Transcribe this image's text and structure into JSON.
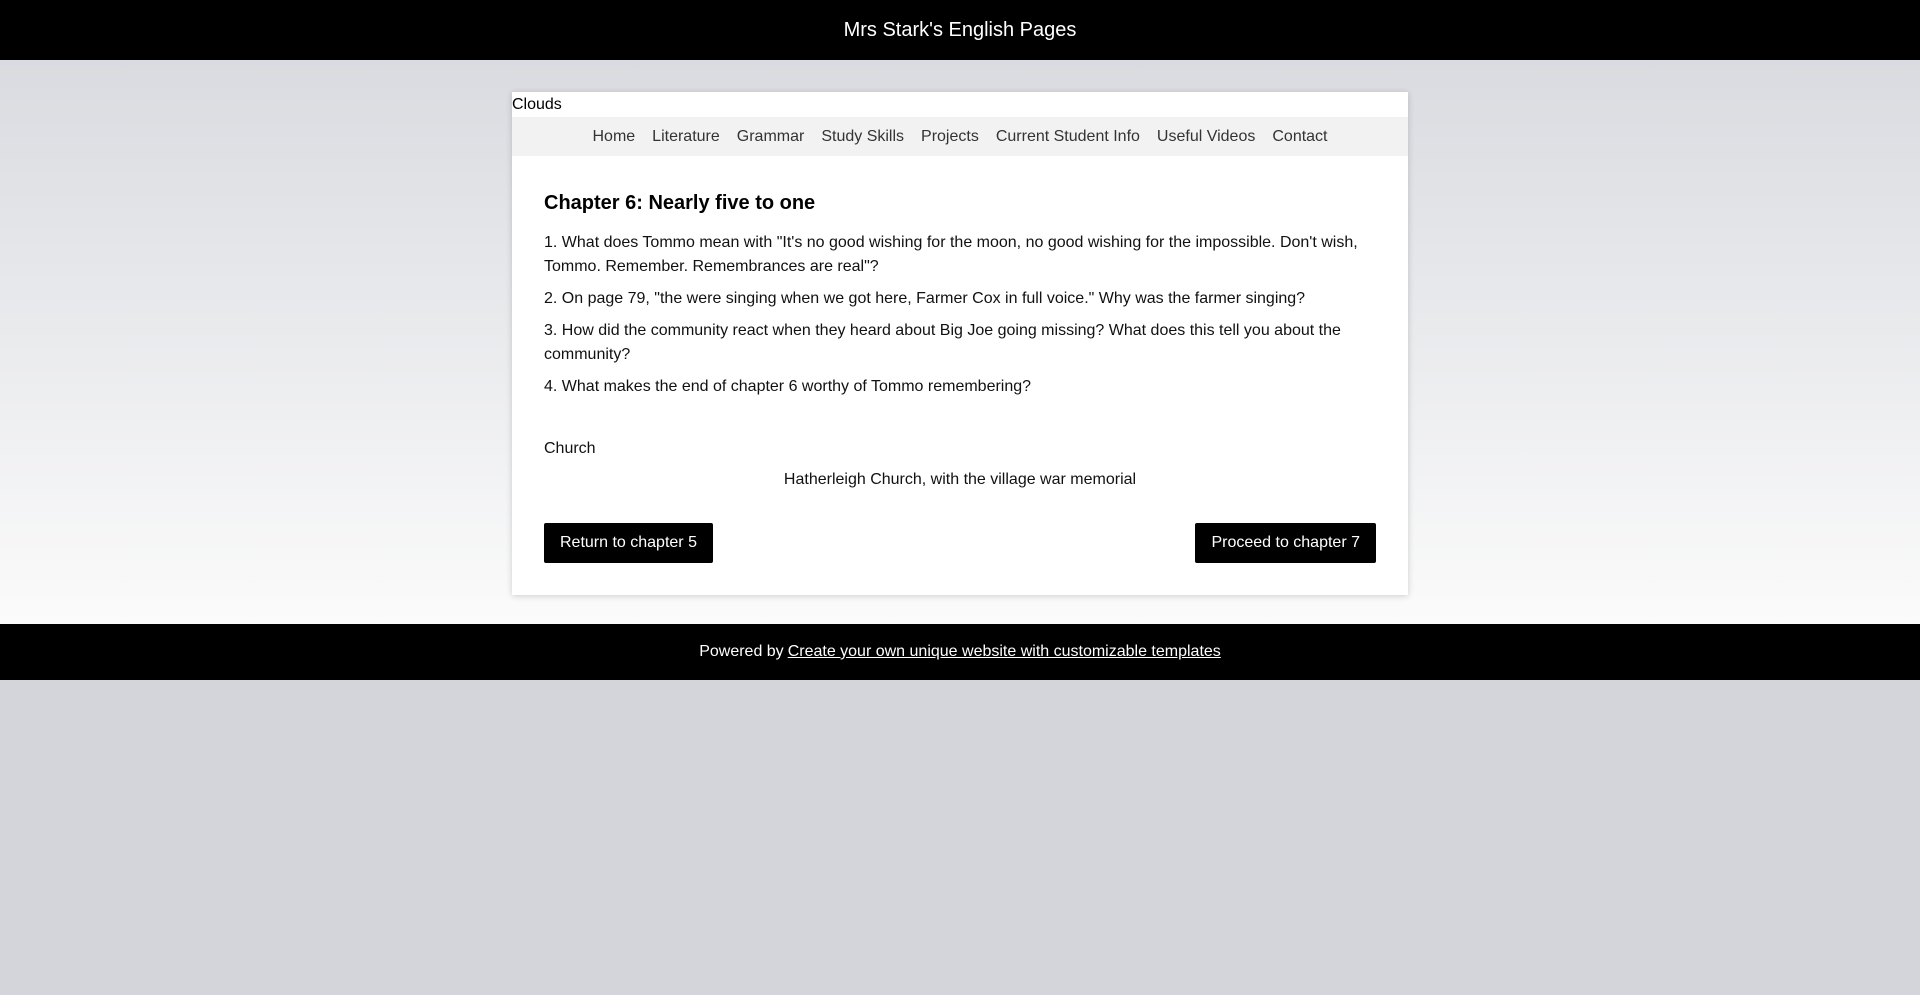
{
  "header": {
    "title": "Mrs Stark's English Pages"
  },
  "banner": {
    "alt_text": "Clouds"
  },
  "nav": {
    "items": [
      {
        "label": "Home"
      },
      {
        "label": "Literature"
      },
      {
        "label": "Grammar"
      },
      {
        "label": "Study Skills"
      },
      {
        "label": "Projects"
      },
      {
        "label": "Current Student Info"
      },
      {
        "label": "Useful Videos"
      },
      {
        "label": "Contact"
      }
    ]
  },
  "main": {
    "title": "Chapter 6: Nearly five to one",
    "questions": [
      "1. What does Tommo mean with \"It's no good wishing for the moon, no good wishing for the impossible. Don't wish, Tommo. Remember. Remembrances are real\"?",
      "2. On page 79, \"the were singing when we got here, Farmer Cox in full voice.\" Why was the farmer singing?",
      "3. How did the community react when they heard about Big Joe going missing? What does this tell you about the community?",
      "4. What makes the end of chapter 6 worthy of Tommo remembering?"
    ],
    "image_alt": "Church",
    "image_caption": "Hatherleigh Church, with the village war memorial",
    "prev_button": "Return to chapter 5",
    "next_button": "Proceed to chapter 7"
  },
  "footer": {
    "prefix": "Powered by",
    "link_text": "Create your own unique website with customizable templates"
  }
}
